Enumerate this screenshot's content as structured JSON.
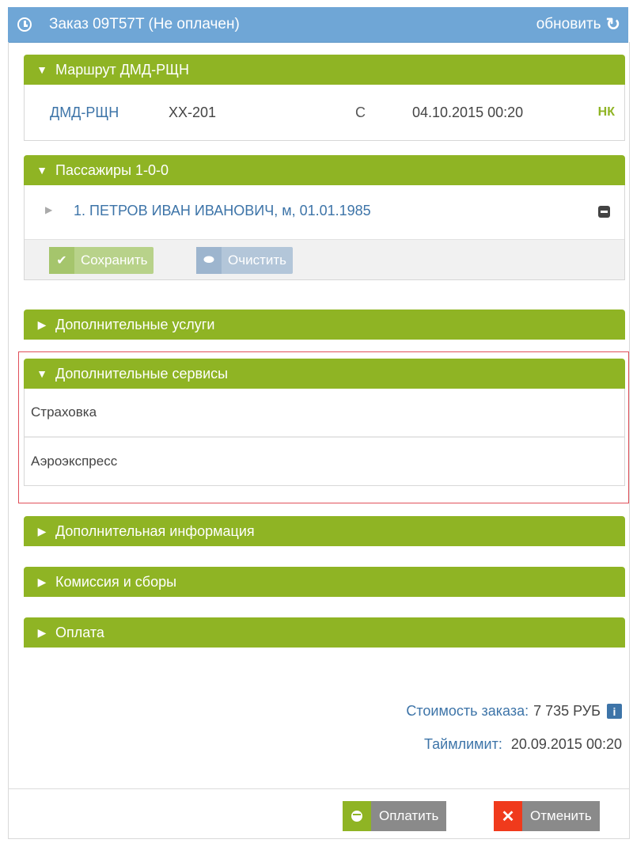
{
  "header": {
    "title": "Заказ 09T57T (Не оплачен)",
    "refresh_label": "обновить",
    "clock_icon": "clock-icon",
    "refresh_icon": "refresh-icon"
  },
  "route": {
    "header": "Маршрут ДМД-РЩН",
    "row": {
      "code": "ДМД-РЩН",
      "flight": "XX-201",
      "class": "C",
      "date": "04.10.2015 00:20",
      "status": "НК"
    }
  },
  "passengers": {
    "header": "Пассажиры 1-0-0",
    "items": [
      "1. ПЕТРОВ ИВАН ИВАНОВИЧ, м, 01.01.1985"
    ],
    "save_label": "Сохранить",
    "clear_label": "Очистить"
  },
  "sections": {
    "extra_services": "Дополнительные услуги",
    "extra_services2": "Дополнительные сервисы",
    "extra_info": "Дополнительная информация",
    "commission": "Комиссия и сборы",
    "payment": "Оплата"
  },
  "services": [
    "Страховка",
    "Аэроэкспресс"
  ],
  "summary": {
    "cost_label": "Стоимость заказа:",
    "cost_value": "7 735 РУБ",
    "timelimit_label": "Таймлимит:",
    "timelimit_value": "20.09.2015 00:20"
  },
  "footer": {
    "pay_label": "Оплатить",
    "cancel_label": "Отменить"
  },
  "colors": {
    "header_bg": "#6fa6d6",
    "section_green": "#8fb424",
    "link_blue": "#3d74a8",
    "cancel_red": "#f03a1c",
    "highlight_red": "#e0505a"
  }
}
